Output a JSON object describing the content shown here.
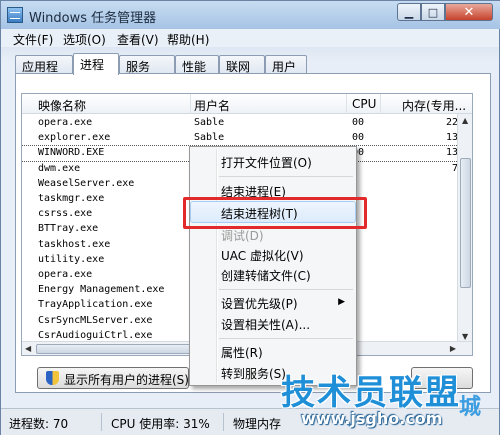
{
  "window": {
    "title": "Windows 任务管理器",
    "min_label": "▁",
    "max_label": "□",
    "close_label": "✕"
  },
  "menu": [
    "文件(F)",
    "选项(O)",
    "查看(V)",
    "帮助(H)"
  ],
  "tabs": [
    "应用程序",
    "进程",
    "服务",
    "性能",
    "联网",
    "用户"
  ],
  "active_tab": "进程",
  "columns": [
    "映像名称",
    "用户名",
    "CPU",
    "内存(专用..."
  ],
  "processes": [
    {
      "name": "opera.exe",
      "user": "Sable",
      "cpu": "00",
      "mem": "22"
    },
    {
      "name": "explorer.exe",
      "user": "Sable",
      "cpu": "00",
      "mem": "13"
    },
    {
      "name": "WINWORD.EXE",
      "user": "Sab",
      "cpu": "00",
      "mem": "13"
    },
    {
      "name": "dwm.exe",
      "user": "",
      "cpu": "",
      "mem": "7"
    },
    {
      "name": "WeaselServer.exe",
      "user": "",
      "cpu": "",
      "mem": ""
    },
    {
      "name": "taskmgr.exe",
      "user": "",
      "cpu": "",
      "mem": ""
    },
    {
      "name": "csrss.exe",
      "user": "",
      "cpu": "",
      "mem": ""
    },
    {
      "name": "BTTray.exe",
      "user": "",
      "cpu": "",
      "mem": ""
    },
    {
      "name": "taskhost.exe",
      "user": "",
      "cpu": "",
      "mem": ""
    },
    {
      "name": "utility.exe",
      "user": "",
      "cpu": "",
      "mem": ""
    },
    {
      "name": "opera.exe",
      "user": "",
      "cpu": "",
      "mem": ""
    },
    {
      "name": "Energy Management.exe",
      "user": "",
      "cpu": "",
      "mem": ""
    },
    {
      "name": "TrayApplication.exe",
      "user": "",
      "cpu": "",
      "mem": ""
    },
    {
      "name": "CsrSyncMLServer.exe",
      "user": "",
      "cpu": "",
      "mem": ""
    },
    {
      "name": "CsrAudioguiCtrl.exe",
      "user": "",
      "cpu": "",
      "mem": ""
    }
  ],
  "selected_process_index": 2,
  "context_menu": {
    "open_location": "打开文件位置(O)",
    "end_process": "结束进程(E)",
    "end_process_tree": "结束进程树(T)",
    "debug": "调试(D)",
    "uac_virtualization": "UAC 虚拟化(V)",
    "create_dump": "创建转储文件(C)",
    "set_priority": "设置优先级(P)",
    "set_affinity": "设置相关性(A)...",
    "properties": "属性(R)",
    "go_to_service": "转到服务(S)",
    "submenu_arrow": "▶"
  },
  "show_all_button": "显示所有用户的进程(S)",
  "status": {
    "process_count": "进程数: 70",
    "cpu_usage": "CPU 使用率: 31%",
    "physical_memory": "物理内存"
  },
  "watermark": {
    "main": "技术员联盟",
    "side": "城",
    "url": "www.jsgho.com"
  },
  "colors": {
    "highlight_border": "#e32a2a",
    "watermark": "#1f8fd8"
  }
}
